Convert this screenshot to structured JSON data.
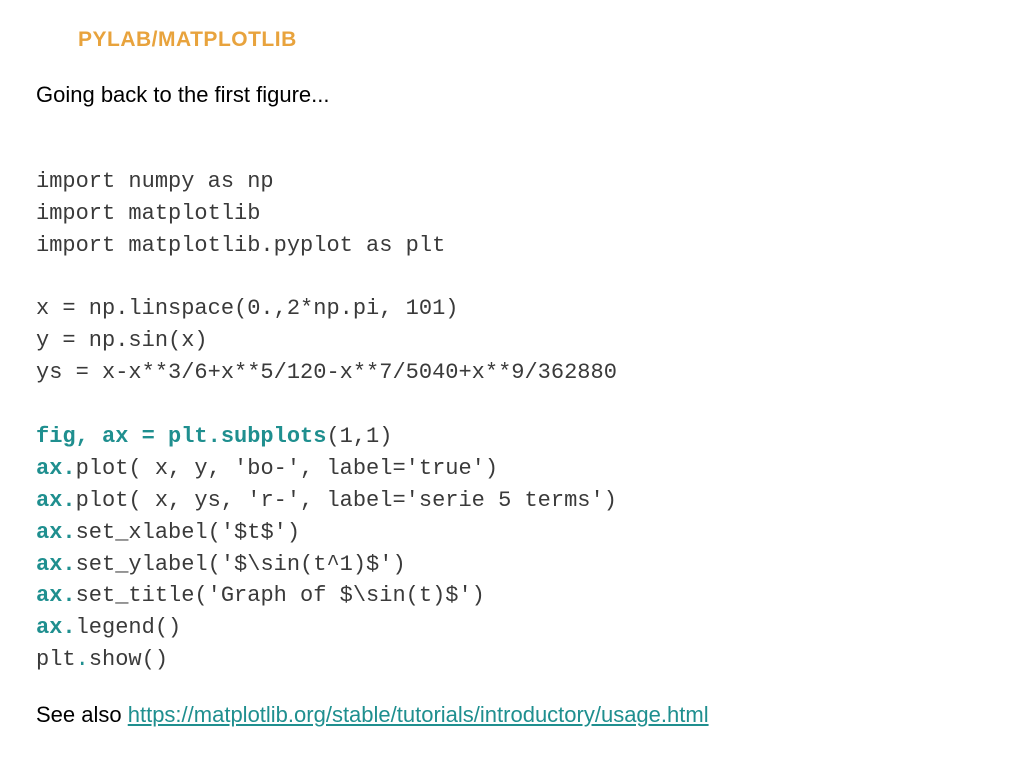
{
  "title": "PYLAB/MATPLOTLIB",
  "intro": "Going back to the first figure...",
  "code": {
    "l1": "import numpy as np",
    "l2": "import matplotlib",
    "l3": "import matplotlib.pyplot as plt",
    "l4": "x = np.linspace(0.,2*np.pi, 101)",
    "l5": "y = np.sin(x)",
    "l6": "ys = x-x**3/6+x**5/120-x**7/5040+x**9/362880",
    "l7a": "fig, ax = plt.subplots",
    "l7b": "(1,1)",
    "l8a": "ax.",
    "l8b": "plot( x, y, 'bo-', label='true')",
    "l9a": "ax.",
    "l9b": "plot( x, ys, 'r-', label='serie 5 terms')",
    "l10a": "ax.",
    "l10b": "set_xlabel('$t$')",
    "l11a": "ax.",
    "l11b": "set_ylabel('$\\sin(t^1)$')",
    "l12a": "ax.",
    "l12b": "set_title('Graph of $\\sin(t)$')",
    "l13a": "ax.",
    "l13b": "legend()",
    "l14a": "plt",
    "l14dot": ".",
    "l14b": "show()"
  },
  "footer_label": "See also ",
  "footer_url": "https://matplotlib.org/stable/tutorials/introductory/usage.html"
}
